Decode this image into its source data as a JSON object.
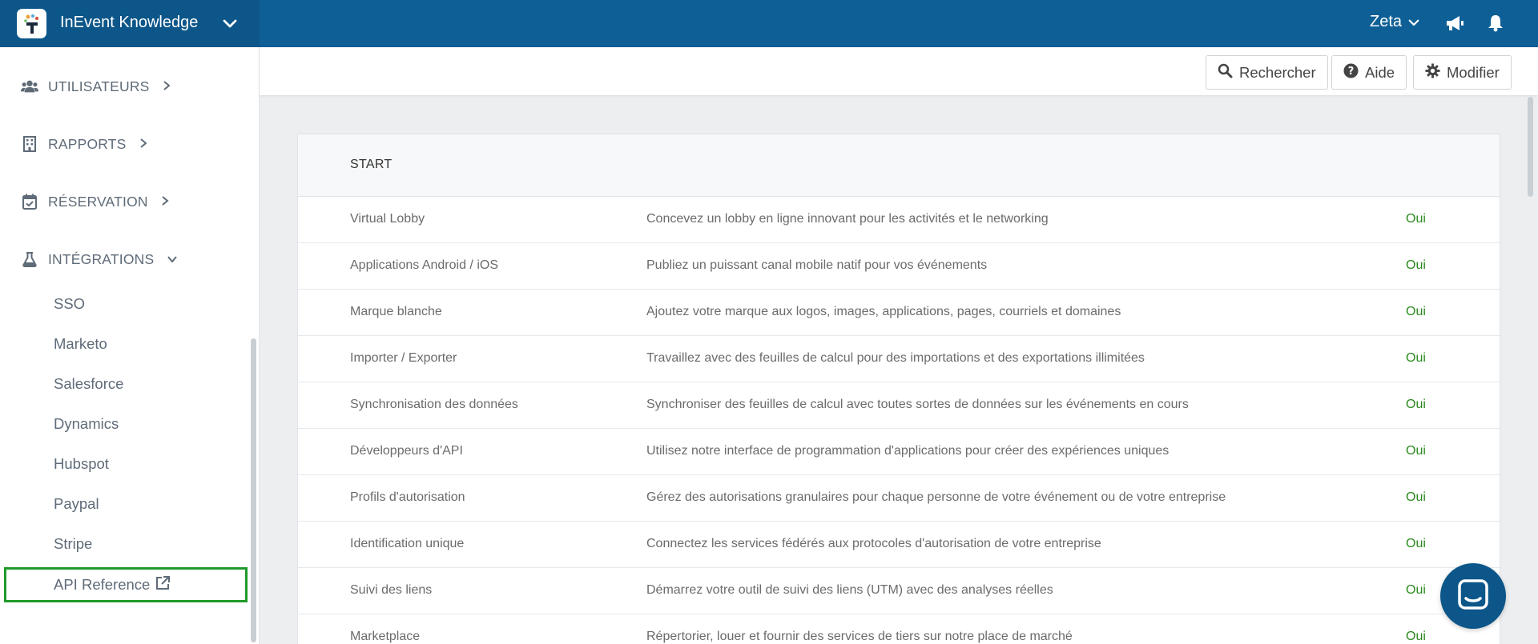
{
  "topbar": {
    "title": "InEvent Knowledge",
    "user": "Zeta"
  },
  "sidebar": {
    "sections": [
      {
        "label": "UTILISATEURS",
        "icon": "users-icon"
      },
      {
        "label": "RAPPORTS",
        "icon": "building-icon"
      },
      {
        "label": "RÉSERVATION",
        "icon": "calendar-check-icon"
      },
      {
        "label": "INTÉGRATIONS",
        "icon": "flask-icon"
      }
    ],
    "integrations": [
      "SSO",
      "Marketo",
      "Salesforce",
      "Dynamics",
      "Hubspot",
      "Paypal",
      "Stripe"
    ],
    "api_reference": "API Reference"
  },
  "header": {
    "search_label": "Rechercher",
    "help_label": "Aide",
    "edit_label": "Modifier"
  },
  "table": {
    "heading": "START",
    "rows": [
      {
        "name": "Virtual Lobby",
        "desc": "Concevez un lobby en ligne innovant pour les activités et le networking",
        "value": "Oui"
      },
      {
        "name": "Applications Android / iOS",
        "desc": "Publiez un puissant canal mobile natif pour vos événements",
        "value": "Oui"
      },
      {
        "name": "Marque blanche",
        "desc": "Ajoutez votre marque aux logos, images, applications, pages, courriels et domaines",
        "value": "Oui"
      },
      {
        "name": "Importer / Exporter",
        "desc": "Travaillez avec des feuilles de calcul pour des importations et des exportations illimitées",
        "value": "Oui"
      },
      {
        "name": "Synchronisation des données",
        "desc": "Synchroniser des feuilles de calcul avec toutes sortes de données sur les événements en cours",
        "value": "Oui"
      },
      {
        "name": "Développeurs d'API",
        "desc": "Utilisez notre interface de programmation d'applications pour créer des expériences uniques",
        "value": "Oui"
      },
      {
        "name": "Profils d'autorisation",
        "desc": "Gérez des autorisations granulaires pour chaque personne de votre événement ou de votre entreprise",
        "value": "Oui"
      },
      {
        "name": "Identification unique",
        "desc": "Connectez les services fédérés aux protocoles d'autorisation de votre entreprise",
        "value": "Oui"
      },
      {
        "name": "Suivi des liens",
        "desc": "Démarrez votre outil de suivi des liens (UTM) avec des analyses réelles",
        "value": "Oui"
      },
      {
        "name": "Marketplace",
        "desc": "Répertorier, louer et fournir des services de tiers sur notre place de marché",
        "value": "Oui"
      }
    ]
  },
  "colors": {
    "topbar": "#0d5f96",
    "brand_bg": "#0c5689",
    "value_green": "#2b8a1e",
    "highlight_border": "#1e9a2a"
  }
}
